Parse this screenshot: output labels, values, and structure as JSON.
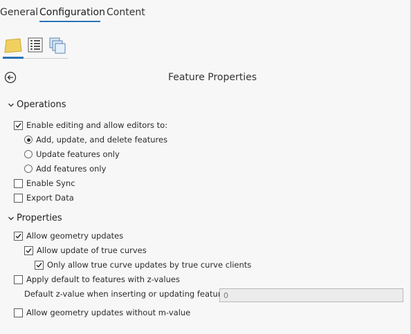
{
  "tabs": [
    {
      "label": "General",
      "active": false
    },
    {
      "label": "Configuration",
      "active": true
    },
    {
      "label": "Content",
      "active": false
    }
  ],
  "icon_tabs": [
    "feature-layer-icon",
    "list-properties-icon",
    "copies-icon"
  ],
  "panel": {
    "title": "Feature Properties",
    "back_icon": "back-arrow-icon"
  },
  "operations": {
    "header": "Operations",
    "enable_editing": {
      "label": "Enable editing and allow editors to:",
      "checked": true
    },
    "options": [
      {
        "label": "Add, update, and delete features",
        "selected": true
      },
      {
        "label": "Update features only",
        "selected": false
      },
      {
        "label": "Add features only",
        "selected": false
      }
    ],
    "enable_sync": {
      "label": "Enable Sync",
      "checked": false
    },
    "export_data": {
      "label": "Export Data",
      "checked": false
    }
  },
  "properties": {
    "header": "Properties",
    "allow_geometry_updates": {
      "label": "Allow geometry updates",
      "checked": true
    },
    "allow_true_curves": {
      "label": "Allow update of true curves",
      "checked": true
    },
    "only_true_curve_clients": {
      "label": "Only allow true curve updates by true curve clients",
      "checked": true
    },
    "apply_default_z": {
      "label": "Apply default to features with z-values",
      "checked": false
    },
    "default_z": {
      "label": "Default z-value when inserting or updating features",
      "value": "0"
    },
    "allow_without_m": {
      "label": "Allow geometry updates without m-value",
      "checked": false
    }
  },
  "colors": {
    "accent": "#2b73b6",
    "layer_icon": "#f0d060",
    "background": "#f7f7f7"
  }
}
